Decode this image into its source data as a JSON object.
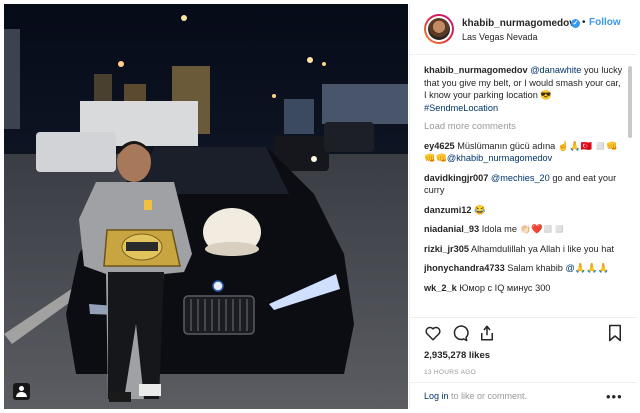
{
  "post": {
    "username": "khabib_nurmagomedov",
    "verified_mark": "✓",
    "follow_dot": "•",
    "follow_label": "Follow",
    "location": "Las Vegas Nevada"
  },
  "caption": {
    "username": "khabib_nurmagomedov",
    "mention": "@danawhite",
    "text": " you lucky that you give my belt, or I would smash your car, I know your parking location 😎",
    "hashtag": "#SendmeLocation"
  },
  "load_more_label": "Load more comments",
  "comments": [
    {
      "user": "ey4625",
      "pre": " Müslümanın gücü adına ☝️🙏🇹🇷 ◻️👊👊👊",
      "mention": "@khabib_nurmagomedov",
      "post": ""
    },
    {
      "user": "davidkingjr007",
      "pre": " ",
      "mention": "@mechies_20",
      "post": " go and eat your curry"
    },
    {
      "user": "danzumi12",
      "pre": " 😂",
      "mention": "",
      "post": ""
    },
    {
      "user": "niadanial_93",
      "pre": " Idola me 👏🏻❤️◻️◻️",
      "mention": "",
      "post": ""
    },
    {
      "user": "rizki_jr305",
      "pre": " Alhamdulillah ya Allah i like you hat",
      "mention": "",
      "post": ""
    },
    {
      "user": "jhonychandra4733",
      "pre": " Salam khabib ",
      "mention": "@",
      "post": "🙏🙏🙏"
    },
    {
      "user": "wk_2_k",
      "pre": " Юмор с IQ минус 300",
      "mention": "",
      "post": ""
    }
  ],
  "likes": "2,935,278 likes",
  "time_ago": "13 HOURS AGO",
  "login": {
    "link": "Log in",
    "rest": " to like or comment."
  },
  "more_label": "•••",
  "icons": [
    "heart-icon",
    "comment-icon",
    "share-icon",
    "bookmark-icon",
    "tagged-user-icon"
  ],
  "colors": {
    "link": "#003569",
    "follow": "#3897f0",
    "muted": "#999999"
  }
}
